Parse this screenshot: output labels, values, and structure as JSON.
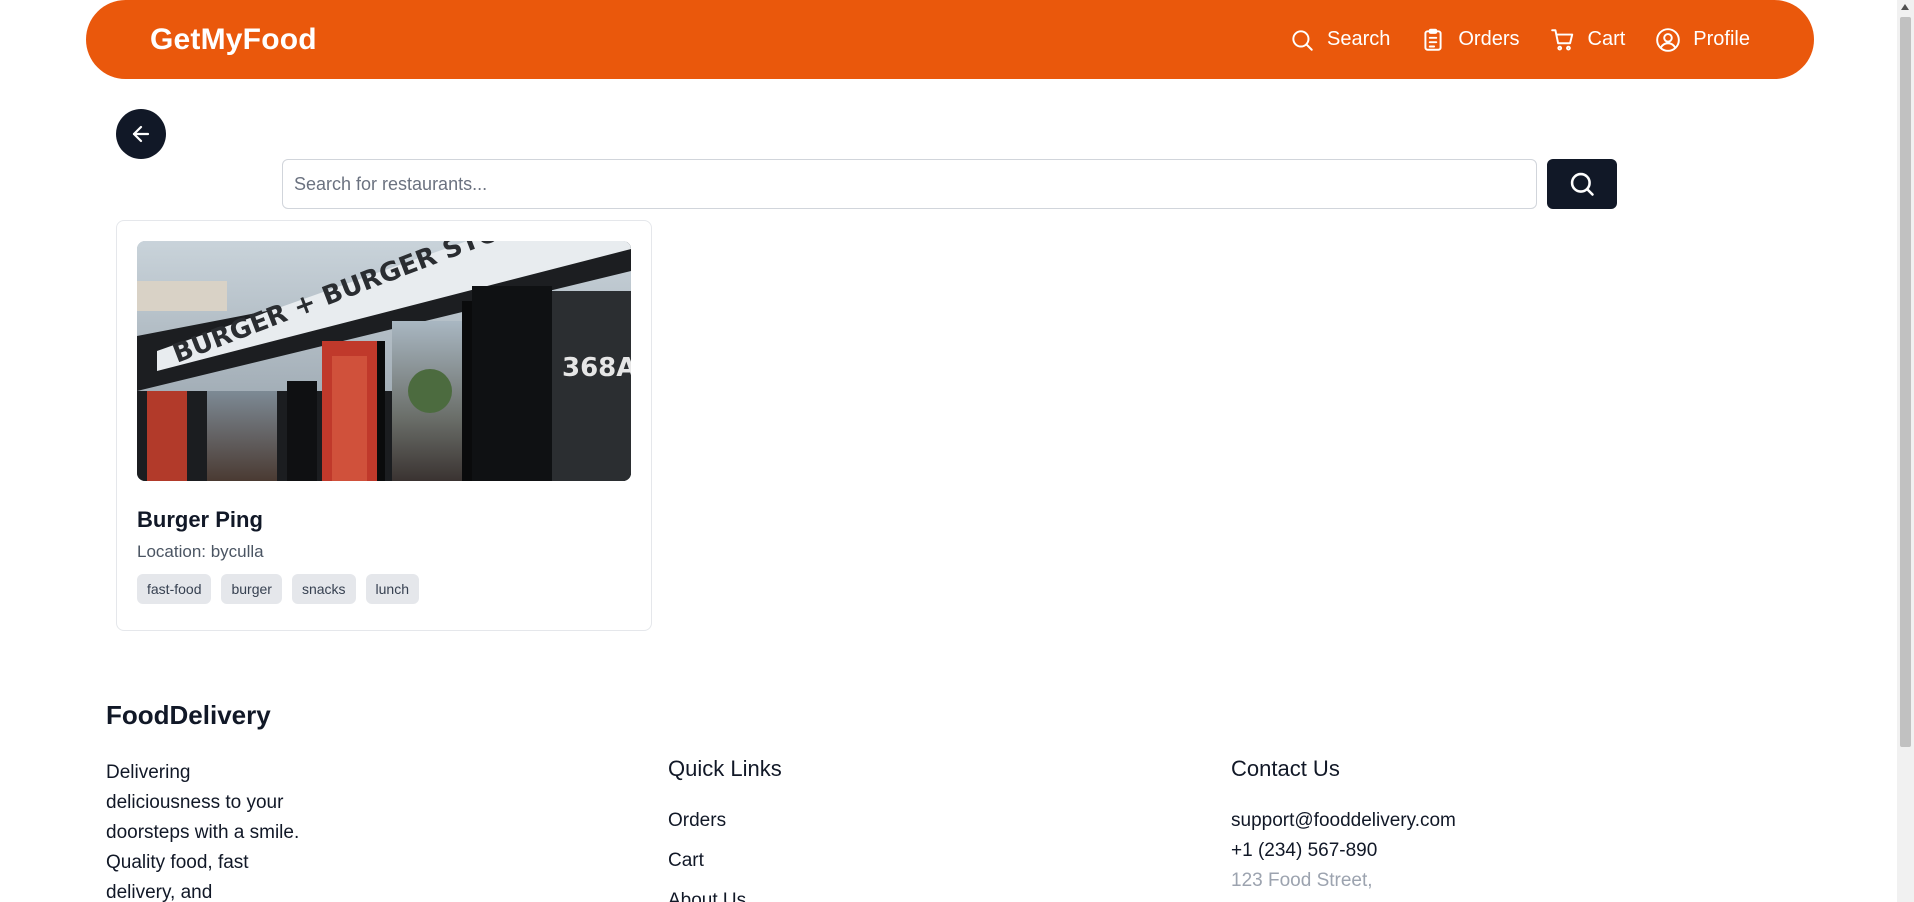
{
  "nav": {
    "brand": "GetMyFood",
    "links": [
      {
        "label": "Search",
        "icon": "search-icon"
      },
      {
        "label": "Orders",
        "icon": "clipboard-icon"
      },
      {
        "label": "Cart",
        "icon": "cart-icon"
      },
      {
        "label": "Profile",
        "icon": "user-circle-icon"
      }
    ]
  },
  "search": {
    "placeholder": "Search for restaurants...",
    "value": ""
  },
  "results": [
    {
      "name": "Burger Ping",
      "location": "Location: byculla",
      "image_sign_text": "BURGER + BURGER STO",
      "image_number": "368A",
      "tags": [
        "fast-food",
        "burger",
        "snacks",
        "lunch"
      ]
    }
  ],
  "footer": {
    "brand": "FoodDelivery",
    "description": "Delivering deliciousness to your doorsteps with a smile. Quality food, fast delivery, and",
    "quick_links_title": "Quick Links",
    "quick_links": [
      "Orders",
      "Cart",
      "About Us"
    ],
    "contact_title": "Contact Us",
    "contact": {
      "email": "support@fooddelivery.com",
      "phone": "+1 (234) 567-890",
      "address": "123 Food Street,"
    }
  },
  "colors": {
    "brand_orange": "#ea580c",
    "dark": "#111827"
  }
}
